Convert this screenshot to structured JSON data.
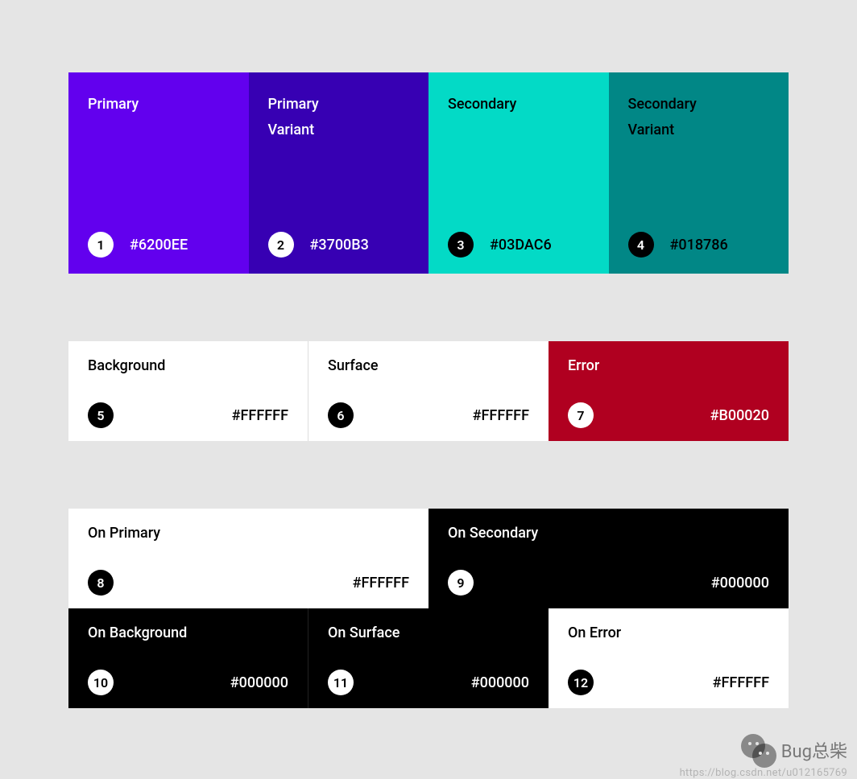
{
  "row1": [
    {
      "label_a": "Primary",
      "label_b": "",
      "bg": "#6200EE",
      "txt": "#FFFFFF",
      "num": "1",
      "badge_bg": "#FFFFFF",
      "badge_txt": "#000000",
      "hex": "#6200EE"
    },
    {
      "label_a": "Primary",
      "label_b": "Variant",
      "bg": "#3700B3",
      "txt": "#FFFFFF",
      "num": "2",
      "badge_bg": "#FFFFFF",
      "badge_txt": "#000000",
      "hex": "#3700B3"
    },
    {
      "label_a": "Secondary",
      "label_b": "",
      "bg": "#03DAC6",
      "txt": "#000000",
      "num": "3",
      "badge_bg": "#000000",
      "badge_txt": "#FFFFFF",
      "hex": "#03DAC6"
    },
    {
      "label_a": "Secondary",
      "label_b": "Variant",
      "bg": "#018786",
      "txt": "#000000",
      "num": "4",
      "badge_bg": "#000000",
      "badge_txt": "#FFFFFF",
      "hex": "#018786"
    }
  ],
  "row2": [
    {
      "label": "Background",
      "bg": "#FFFFFF",
      "txt": "#000000",
      "num": "5",
      "badge_bg": "#000000",
      "badge_txt": "#FFFFFF",
      "hex": "#FFFFFF"
    },
    {
      "label": "Surface",
      "bg": "#FFFFFF",
      "txt": "#000000",
      "num": "6",
      "badge_bg": "#000000",
      "badge_txt": "#FFFFFF",
      "hex": "#FFFFFF"
    },
    {
      "label": "Error",
      "bg": "#B00020",
      "txt": "#FFFFFF",
      "num": "7",
      "badge_bg": "#FFFFFF",
      "badge_txt": "#000000",
      "hex": "#B00020"
    }
  ],
  "row3": [
    {
      "label": "On Primary",
      "bg": "#FFFFFF",
      "txt": "#000000",
      "num": "8",
      "badge_bg": "#000000",
      "badge_txt": "#FFFFFF",
      "hex": "#FFFFFF"
    },
    {
      "label": "On Secondary",
      "bg": "#000000",
      "txt": "#FFFFFF",
      "num": "9",
      "badge_bg": "#FFFFFF",
      "badge_txt": "#000000",
      "hex": "#000000"
    }
  ],
  "row4": [
    {
      "label": "On Background",
      "bg": "#000000",
      "txt": "#FFFFFF",
      "num": "10",
      "badge_bg": "#FFFFFF",
      "badge_txt": "#000000",
      "hex": "#000000"
    },
    {
      "label": "On Surface",
      "bg": "#000000",
      "txt": "#FFFFFF",
      "num": "11",
      "badge_bg": "#FFFFFF",
      "badge_txt": "#000000",
      "hex": "#000000"
    },
    {
      "label": "On Error",
      "bg": "#FFFFFF",
      "txt": "#000000",
      "num": "12",
      "badge_bg": "#000000",
      "badge_txt": "#FFFFFF",
      "hex": "#FFFFFF"
    }
  ],
  "watermark": {
    "text": "Bug总柴",
    "url": "https://blog.csdn.net/u012165769"
  }
}
